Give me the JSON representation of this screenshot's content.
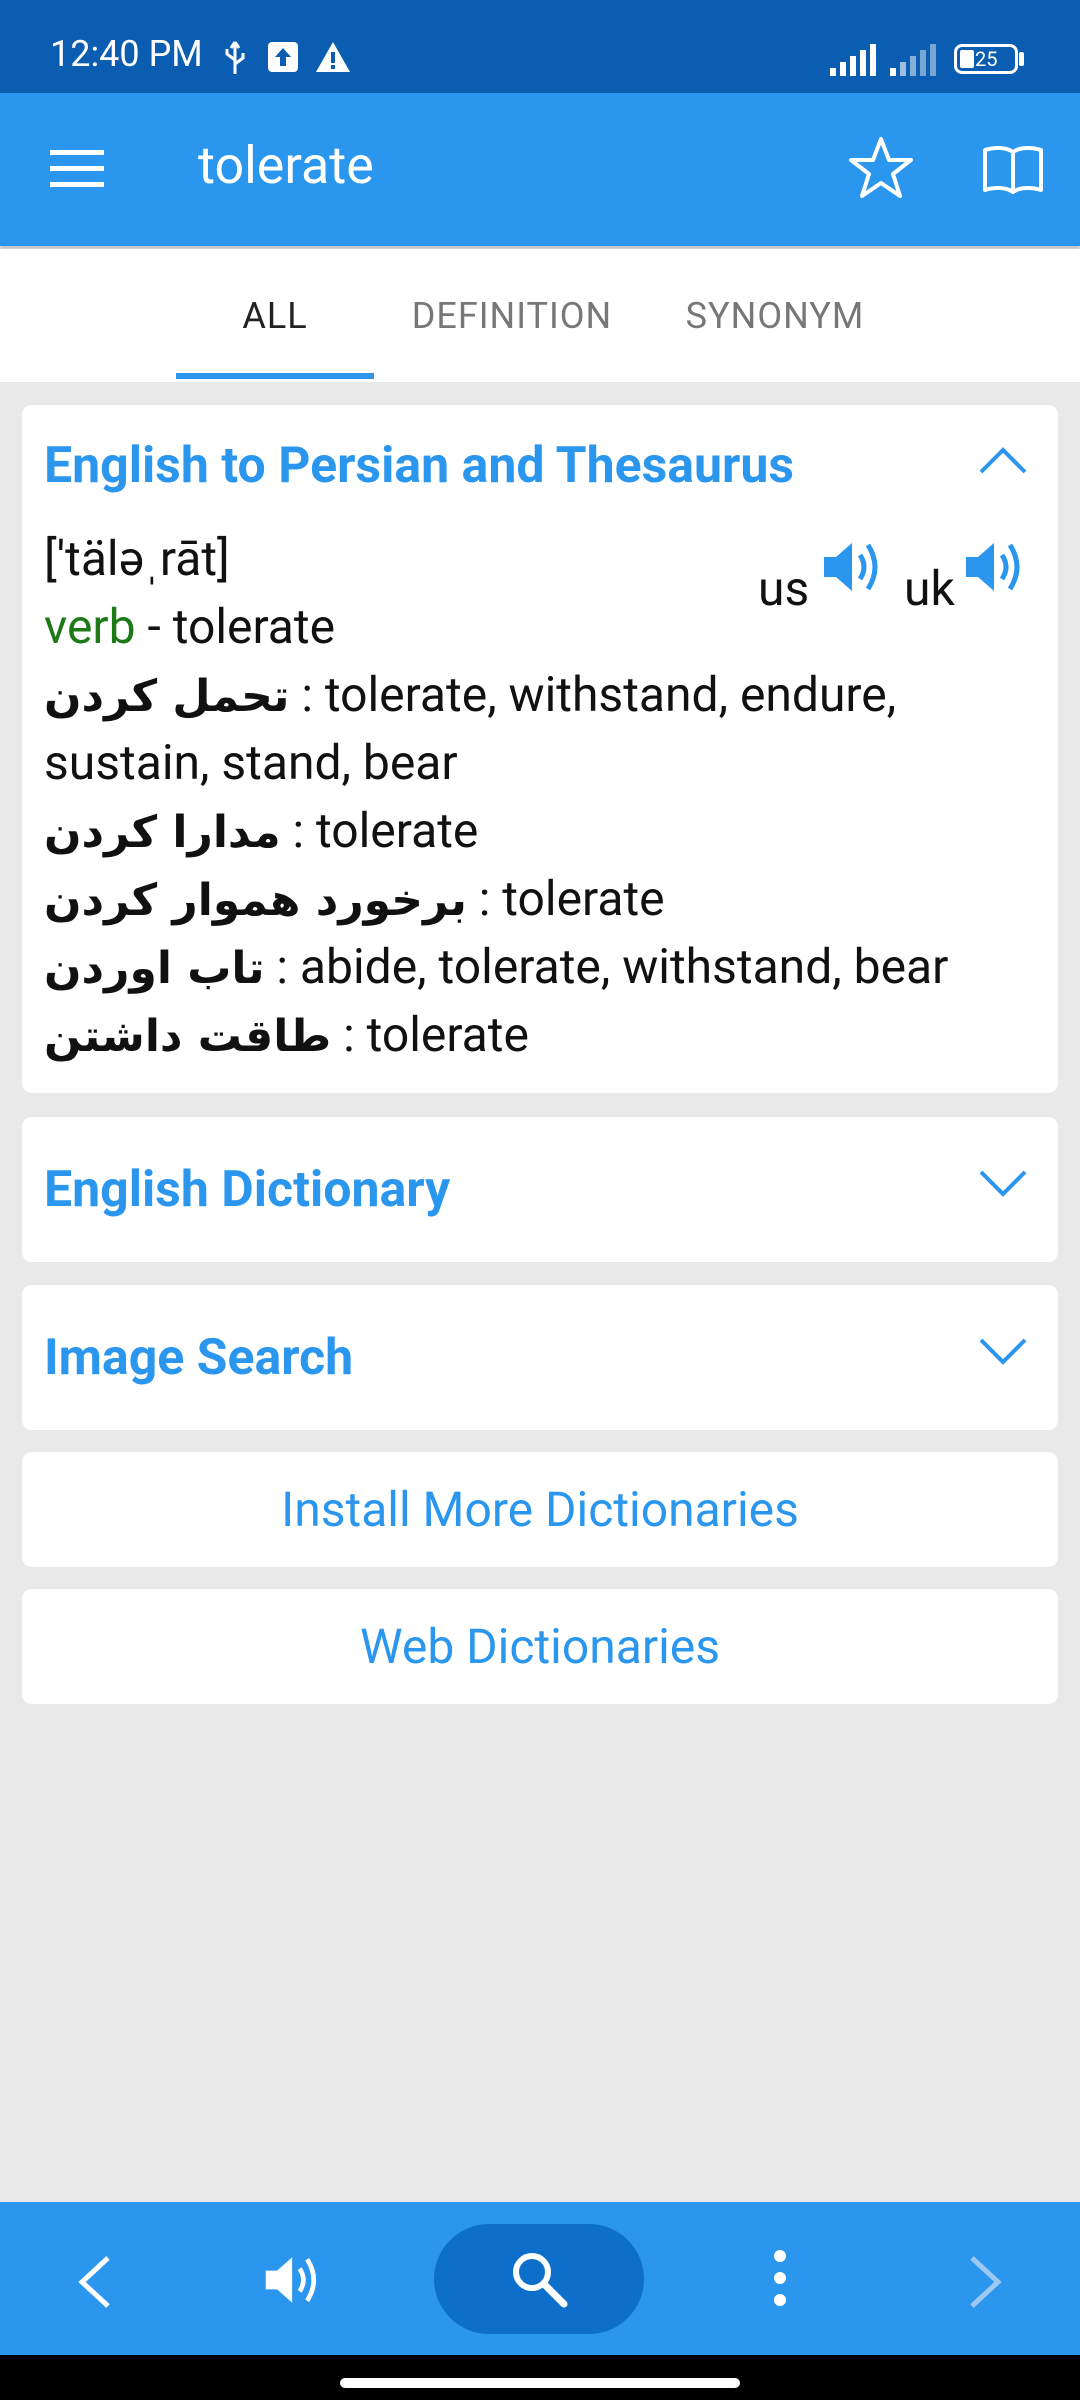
{
  "status_bar": {
    "time": "12:40 PM",
    "battery": "25"
  },
  "app_bar": {
    "title": "tolerate",
    "icons": [
      "menu-icon",
      "star-icon",
      "book-icon"
    ]
  },
  "tabs": [
    {
      "label": "ALL",
      "active": true
    },
    {
      "label": "DEFINITION",
      "active": false
    },
    {
      "label": "SYNONYM",
      "active": false
    }
  ],
  "card_persian": {
    "title": "English to Persian and Thesaurus",
    "pronunciation": "['täləˌrāt]",
    "us_label": "us",
    "uk_label": "uk",
    "pos": "verb",
    "headword": " - tolerate",
    "lines": [
      {
        "fa": "تحمل کردن",
        "text": " : tolerate, withstand, endure,"
      },
      {
        "fa": "",
        "text": "sustain, stand, bear"
      },
      {
        "fa": "مدارا کردن",
        "text": " : tolerate"
      },
      {
        "fa": "برخورد هموار کردن",
        "text": " : tolerate"
      },
      {
        "fa": "تاب اوردن",
        "text": " : abide, tolerate, withstand, bear"
      },
      {
        "fa": "طاقت داشتن",
        "text": " : tolerate"
      }
    ]
  },
  "card_english": {
    "title": "English Dictionary"
  },
  "card_image": {
    "title": "Image Search"
  },
  "install_more": "Install More Dictionaries",
  "web_dictionaries": "Web Dictionaries",
  "colors": {
    "status_bar": "#0a5db0",
    "app_bar": "#2b96ee",
    "accent": "#2b96ee",
    "verb": "#1d7a17",
    "background": "#e9e9e9"
  }
}
